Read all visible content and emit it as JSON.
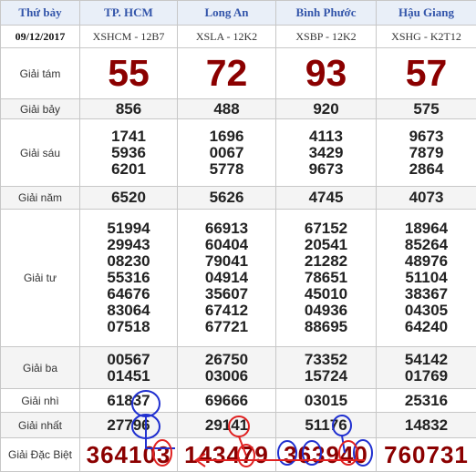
{
  "header": {
    "day_label": "Thứ bảy",
    "provinces": [
      "TP. HCM",
      "Long An",
      "Bình Phước",
      "Hậu Giang"
    ]
  },
  "subheader": {
    "date": "09/12/2017",
    "codes": [
      "XSHCM - 12B7",
      "XSLA - 12K2",
      "XSBP - 12K2",
      "XSHG - K2T12"
    ]
  },
  "prizes": [
    {
      "label": "Giải tám",
      "values": [
        [
          "55"
        ],
        [
          "72"
        ],
        [
          "93"
        ],
        [
          "57"
        ]
      ]
    },
    {
      "label": "Giải bảy",
      "values": [
        [
          "856"
        ],
        [
          "488"
        ],
        [
          "920"
        ],
        [
          "575"
        ]
      ]
    },
    {
      "label": "Giải sáu",
      "values": [
        [
          "1741",
          "5936",
          "6201"
        ],
        [
          "1696",
          "0067",
          "5778"
        ],
        [
          "4113",
          "3429",
          "9673"
        ],
        [
          "9673",
          "7879",
          "2864"
        ]
      ]
    },
    {
      "label": "Giải năm",
      "values": [
        [
          "6520"
        ],
        [
          "5626"
        ],
        [
          "4745"
        ],
        [
          "4073"
        ]
      ]
    },
    {
      "label": "Giải tư",
      "values": [
        [
          "51994",
          "29943",
          "08230",
          "55316",
          "64676",
          "83064",
          "07518"
        ],
        [
          "66913",
          "60404",
          "79041",
          "04914",
          "35607",
          "67412",
          "67721"
        ],
        [
          "67152",
          "20541",
          "21282",
          "78651",
          "45010",
          "04936",
          "88695"
        ],
        [
          "18964",
          "85264",
          "48976",
          "51104",
          "38367",
          "04305",
          "64240"
        ]
      ]
    },
    {
      "label": "Giải ba",
      "values": [
        [
          "00567",
          "01451"
        ],
        [
          "26750",
          "03006"
        ],
        [
          "73352",
          "15724"
        ],
        [
          "54142",
          "01769"
        ]
      ]
    },
    {
      "label": "Giải nhì",
      "values": [
        [
          "61837"
        ],
        [
          "69666"
        ],
        [
          "03015"
        ],
        [
          "25316"
        ]
      ]
    },
    {
      "label": "Giải nhất",
      "values": [
        [
          "27796"
        ],
        [
          "29141"
        ],
        [
          "51176"
        ],
        [
          "14832"
        ]
      ]
    },
    {
      "label": "Giải Đặc Biệt",
      "values": [
        [
          "364103"
        ],
        [
          "143479"
        ],
        [
          "363940"
        ],
        [
          "760731"
        ]
      ]
    }
  ],
  "colors": {
    "header_text": "#3355aa",
    "big_number": "#8b0000",
    "annotation_red": "#e02020",
    "annotation_blue": "#2030d0"
  }
}
